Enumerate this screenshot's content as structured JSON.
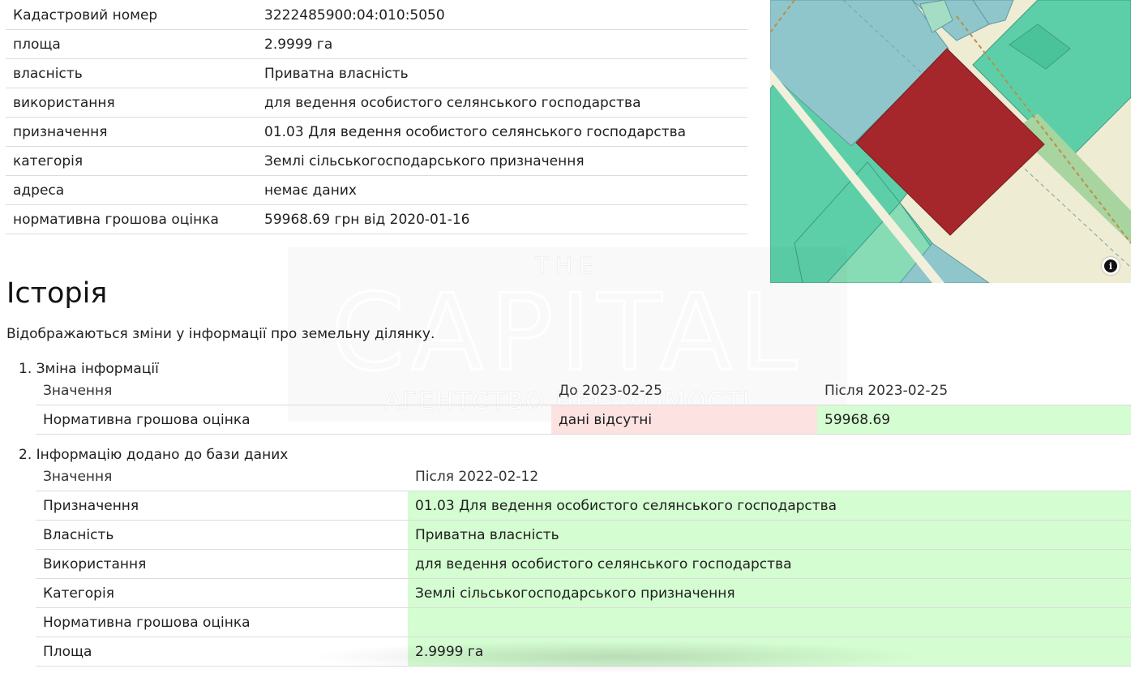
{
  "properties": [
    {
      "label": "Кадастровий номер",
      "value": "3222485900:04:010:5050"
    },
    {
      "label": "площа",
      "value": "2.9999 га"
    },
    {
      "label": "власність",
      "value": "Приватна власність"
    },
    {
      "label": "використання",
      "value": "для ведення особистого селянського господарства"
    },
    {
      "label": "призначення",
      "value": "01.03 Для ведення особистого селянського господарства"
    },
    {
      "label": "категорія",
      "value": "Землі сільськогосподарського призначення"
    },
    {
      "label": "адреса",
      "value": "немає даних"
    },
    {
      "label": "нормативна грошова оцінка",
      "value": "59968.69 грн від 2020-01-16"
    }
  ],
  "map": {
    "info_icon": "i",
    "parcel_color": "#a5272b"
  },
  "watermark": {
    "line1": "THE",
    "line2": "CAPITAL",
    "line3": "АГЕНТСТВО НЕРУХОМОСТІ"
  },
  "history": {
    "title": "Історія",
    "description": "Відображаються зміни у інформації про земельну ділянку.",
    "entries": [
      {
        "title": "1. Зміна інформації",
        "headers": [
          "Значення",
          "До 2023-02-25",
          "Після 2023-02-25"
        ],
        "rows": [
          {
            "field": "Нормативна грошова оцінка",
            "before": "дані відсутні",
            "after": "59968.69"
          }
        ]
      },
      {
        "title": "2. Інформацію додано до бази даних",
        "headers": [
          "Значення",
          "Після 2022-02-12"
        ],
        "rows": [
          {
            "field": "Призначення",
            "after": "01.03 Для ведення особистого селянського господарства"
          },
          {
            "field": "Власність",
            "after": "Приватна власність"
          },
          {
            "field": "Використання",
            "after": "для ведення особистого селянського господарства"
          },
          {
            "field": "Категорія",
            "after": "Землі сільськогосподарського призначення"
          },
          {
            "field": "Нормативна грошова оцінка",
            "after": ""
          },
          {
            "field": "Площа",
            "after": "2.9999 га"
          }
        ]
      }
    ]
  }
}
